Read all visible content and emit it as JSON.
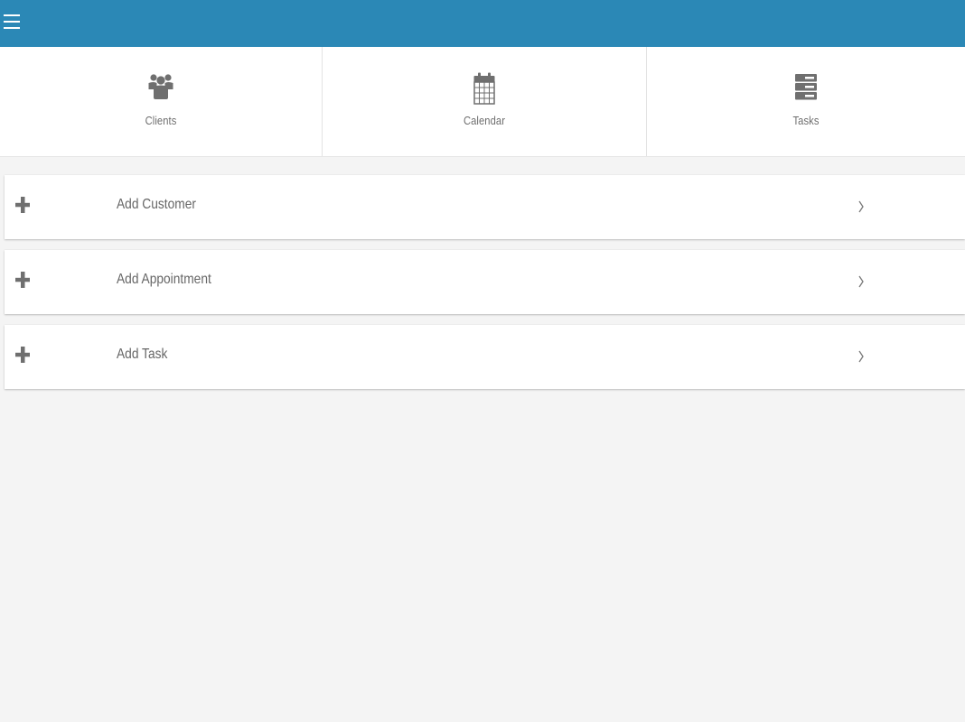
{
  "header": {
    "menu_icon": "hamburger-menu-icon",
    "background_color": "#2b88b6"
  },
  "shortcuts": [
    {
      "label": "Clients",
      "icon": "users-icon"
    },
    {
      "label": "Calendar",
      "icon": "calendar-icon"
    },
    {
      "label": "Tasks",
      "icon": "tasks-stack-icon"
    }
  ],
  "actions": [
    {
      "label": "Add Customer",
      "icon": "plus-icon",
      "trailing_icon": "chevron-right-icon"
    },
    {
      "label": "Add Appointment",
      "icon": "plus-icon",
      "trailing_icon": "chevron-right-icon"
    },
    {
      "label": "Add Task",
      "icon": "plus-icon",
      "trailing_icon": "chevron-right-icon"
    }
  ],
  "colors": {
    "accent": "#2b88b6",
    "icon_gray": "#6f6f6f",
    "text_gray": "#666666",
    "background": "#f4f4f4"
  }
}
